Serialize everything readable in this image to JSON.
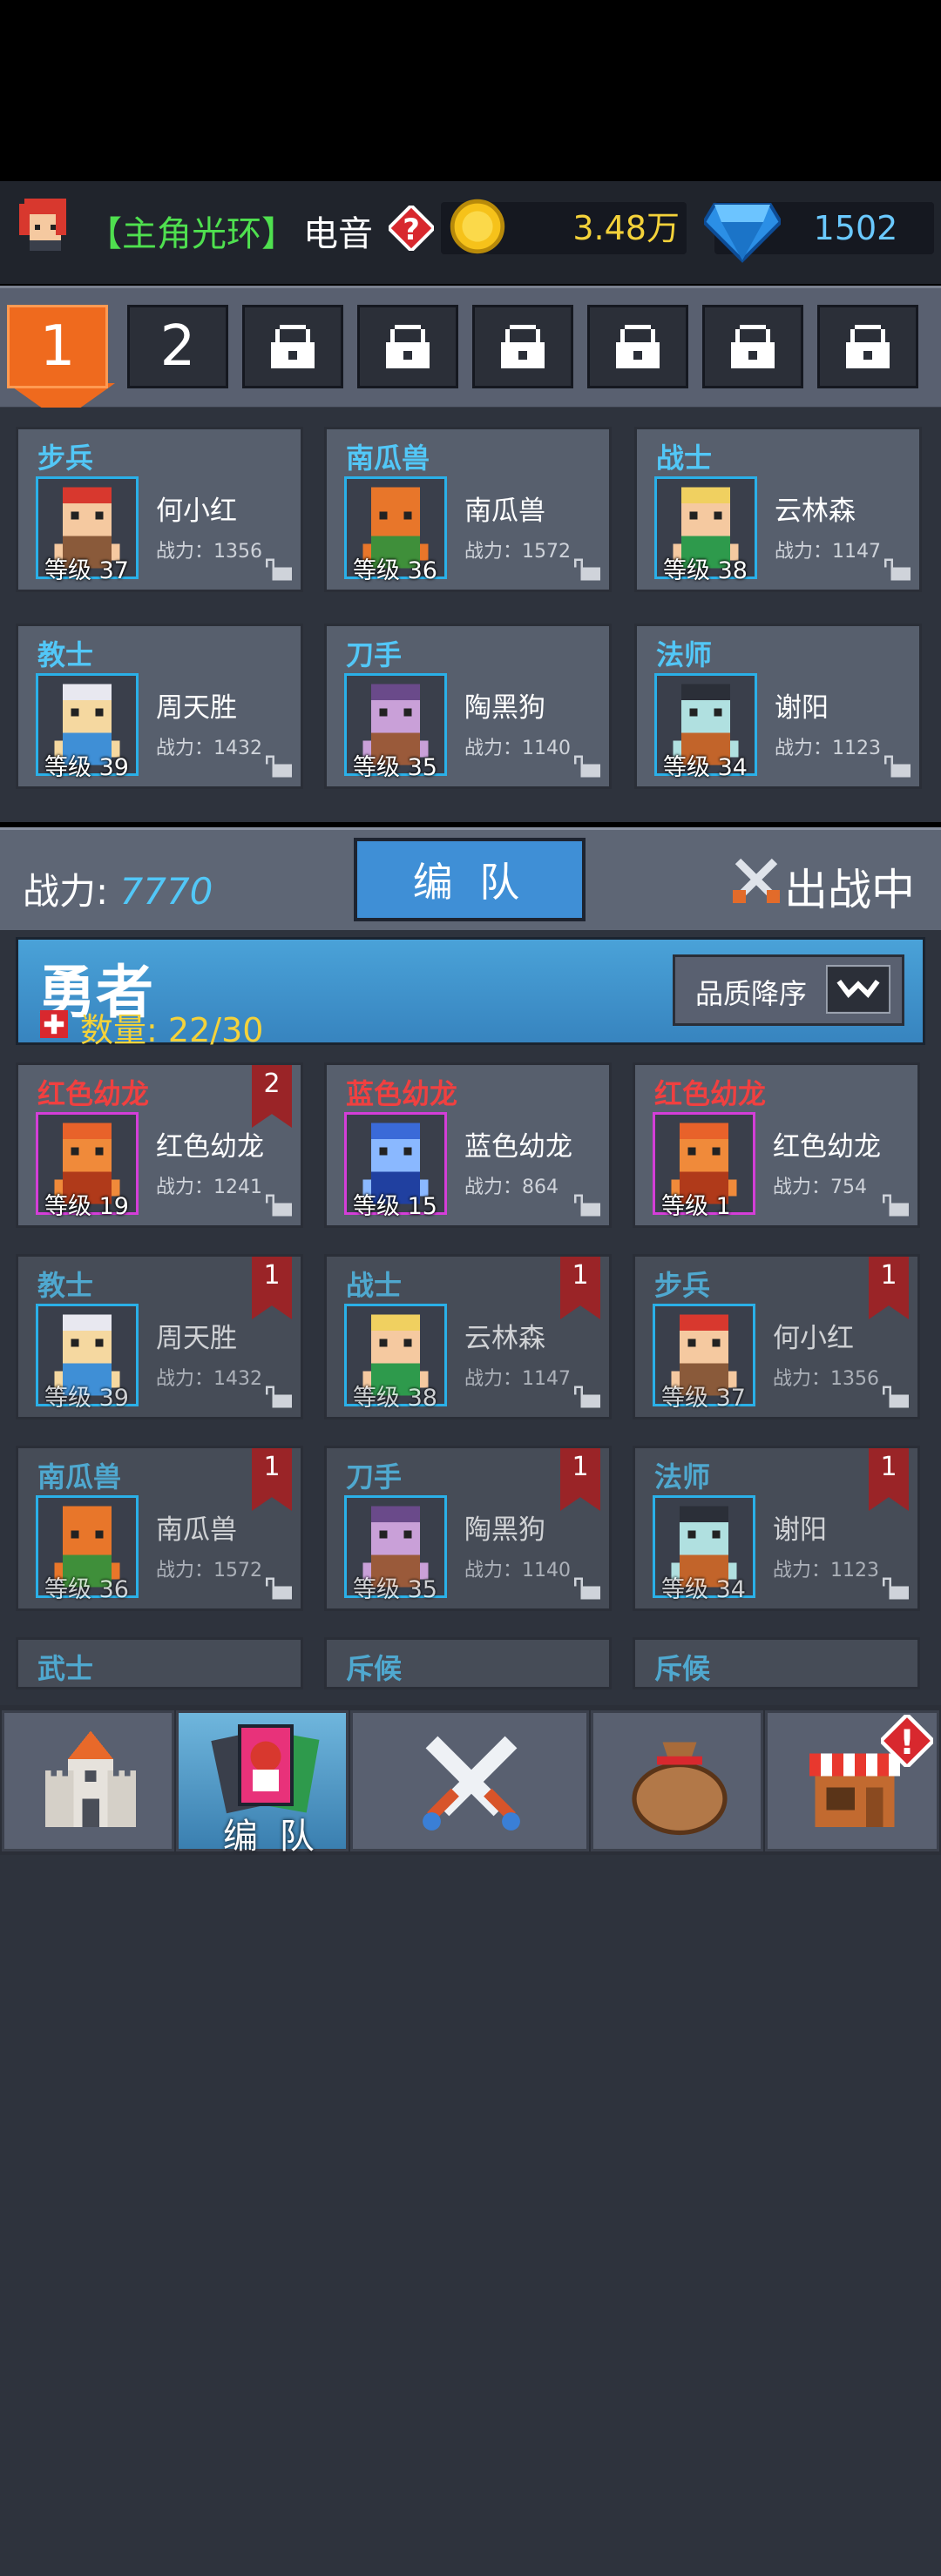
{
  "header": {
    "aura_bracket": "【主角光环】",
    "aura_name": "电音",
    "coins": "3.48万",
    "gems": "1502"
  },
  "tabs": {
    "tab1": "1",
    "tab2": "2",
    "locked_count": 6
  },
  "party": [
    {
      "cls": "步兵",
      "name": "何小红",
      "power": "战力：1356",
      "level": "等级 37"
    },
    {
      "cls": "南瓜兽",
      "name": "南瓜兽",
      "power": "战力：1572",
      "level": "等级 36"
    },
    {
      "cls": "战士",
      "name": "云林森",
      "power": "战力：1147",
      "level": "等级 38"
    },
    {
      "cls": "教士",
      "name": "周天胜",
      "power": "战力：1432",
      "level": "等级 39"
    },
    {
      "cls": "刀手",
      "name": "陶黑狗",
      "power": "战力：1140",
      "level": "等级 35"
    },
    {
      "cls": "法师",
      "name": "谢阳",
      "power": "战力：1123",
      "level": "等级 34"
    }
  ],
  "power_bar": {
    "label": "战力:",
    "value": "7770",
    "formation_button": "编 队",
    "status": "出战中"
  },
  "hero_section": {
    "title": "勇者",
    "count_label": "数量:",
    "count_value": "22/30",
    "sort_label": "品质降序"
  },
  "heroes": [
    {
      "cls": "红色幼龙",
      "name": "红色幼龙",
      "power": "战力：1241",
      "level": "等级 19",
      "badge": "2"
    },
    {
      "cls": "蓝色幼龙",
      "name": "蓝色幼龙",
      "power": "战力：864",
      "level": "等级 15",
      "badge": ""
    },
    {
      "cls": "红色幼龙",
      "name": "红色幼龙",
      "power": "战力：754",
      "level": "等级 1",
      "badge": ""
    },
    {
      "cls": "教士",
      "name": "周天胜",
      "power": "战力：1432",
      "level": "等级 39",
      "badge": "1"
    },
    {
      "cls": "战士",
      "name": "云林森",
      "power": "战力：1147",
      "level": "等级 38",
      "badge": "1"
    },
    {
      "cls": "步兵",
      "name": "何小红",
      "power": "战力：1356",
      "level": "等级 37",
      "badge": "1"
    },
    {
      "cls": "南瓜兽",
      "name": "南瓜兽",
      "power": "战力：1572",
      "level": "等级 36",
      "badge": "1"
    },
    {
      "cls": "刀手",
      "name": "陶黑狗",
      "power": "战力：1140",
      "level": "等级 35",
      "badge": "1"
    },
    {
      "cls": "法师",
      "name": "谢阳",
      "power": "战力：1123",
      "level": "等级 34",
      "badge": "1"
    },
    {
      "cls": "武士"
    },
    {
      "cls": "斥候"
    },
    {
      "cls": "斥候"
    }
  ],
  "nav": {
    "formation_label": "编 队",
    "icons": [
      "castle-icon",
      "cards-icon",
      "crossed-swords-icon",
      "loot-bag-icon",
      "shop-icon"
    ]
  },
  "colors": {
    "accent_orange": "#ef6a1e",
    "blue_button": "#3f8fd6",
    "class_blue": "#52c7f7",
    "class_red": "#f04040",
    "gold_text": "#f4d23a"
  }
}
